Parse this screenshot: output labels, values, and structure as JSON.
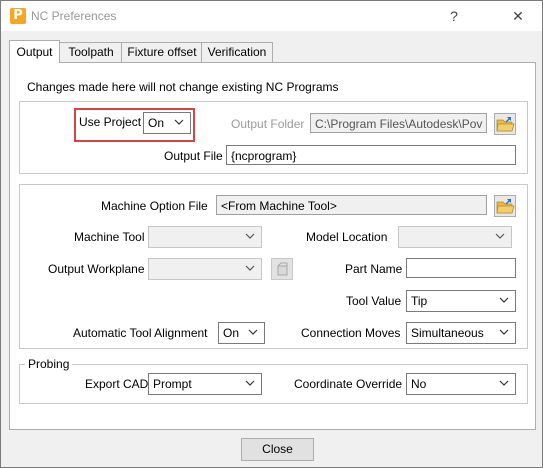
{
  "window": {
    "title": "NC Preferences",
    "help": "?",
    "close": "✕",
    "app_icon": "P"
  },
  "tabs": [
    {
      "label": "Output"
    },
    {
      "label": "Toolpath"
    },
    {
      "label": "Fixture offset"
    },
    {
      "label": "Verification"
    }
  ],
  "notice": "Changes made here will not change existing NC Programs",
  "output": {
    "use_project_label": "Use Project",
    "use_project_value": "On",
    "output_folder_label": "Output Folder",
    "output_folder_value": "C:\\Program Files\\Autodesk\\Pov",
    "output_file_label": "Output File",
    "output_file_value": "{ncprogram}"
  },
  "machine": {
    "option_file_label": "Machine Option File",
    "option_file_value": "<From Machine Tool>",
    "machine_tool_label": "Machine Tool",
    "machine_tool_value": "",
    "model_location_label": "Model Location",
    "model_location_value": "",
    "output_workplane_label": "Output Workplane",
    "output_workplane_value": "",
    "part_name_label": "Part Name",
    "part_name_value": "",
    "tool_value_label": "Tool Value",
    "tool_value_value": "Tip",
    "auto_align_label": "Automatic Tool Alignment",
    "auto_align_value": "On",
    "connection_moves_label": "Connection Moves",
    "connection_moves_value": "Simultaneous"
  },
  "probing": {
    "group_label": "Probing",
    "export_cad_label": "Export CAD",
    "export_cad_value": "Prompt",
    "coord_override_label": "Coordinate Override",
    "coord_override_value": "No"
  },
  "footer": {
    "close_label": "Close"
  },
  "colors": {
    "highlight": "#d64545",
    "icon_orange": "#f5a623"
  }
}
